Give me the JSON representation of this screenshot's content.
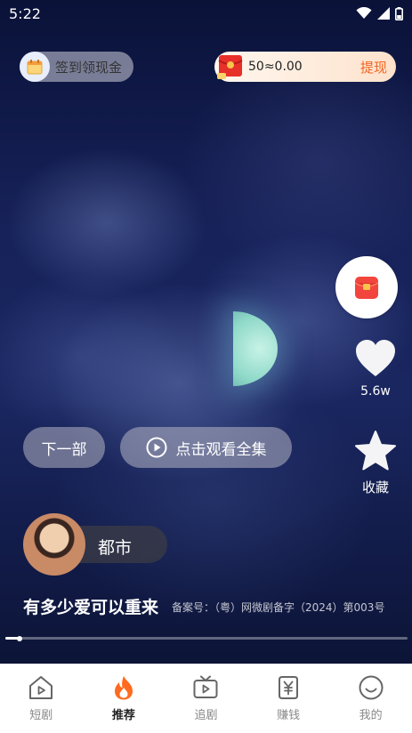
{
  "status_bar": {
    "time": "5:22"
  },
  "top": {
    "checkin_label": "签到领现金",
    "wallet_amount": "50≈0.00",
    "withdraw_label": "提现"
  },
  "side_actions": {
    "like_count": "5.6w",
    "favorite_label": "收藏"
  },
  "buttons": {
    "next_label": "下一部",
    "watch_all_label": "点击观看全集"
  },
  "drama": {
    "genre": "都市",
    "title": "有多少爱可以重来",
    "record_number": "备案号：（粤）网微剧备字（2024）第003号"
  },
  "playback": {
    "progress": 0.035
  },
  "tabbar": {
    "items": [
      {
        "label": "短剧",
        "icon": "play-house-icon",
        "active": false
      },
      {
        "label": "推荐",
        "icon": "flame-icon",
        "active": true
      },
      {
        "label": "追剧",
        "icon": "tv-icon",
        "active": false
      },
      {
        "label": "赚钱",
        "icon": "yuan-icon",
        "active": false
      },
      {
        "label": "我的",
        "icon": "smiley-icon",
        "active": false
      }
    ]
  },
  "colors": {
    "accent": "#f06420",
    "redpack": "#f2453d"
  }
}
